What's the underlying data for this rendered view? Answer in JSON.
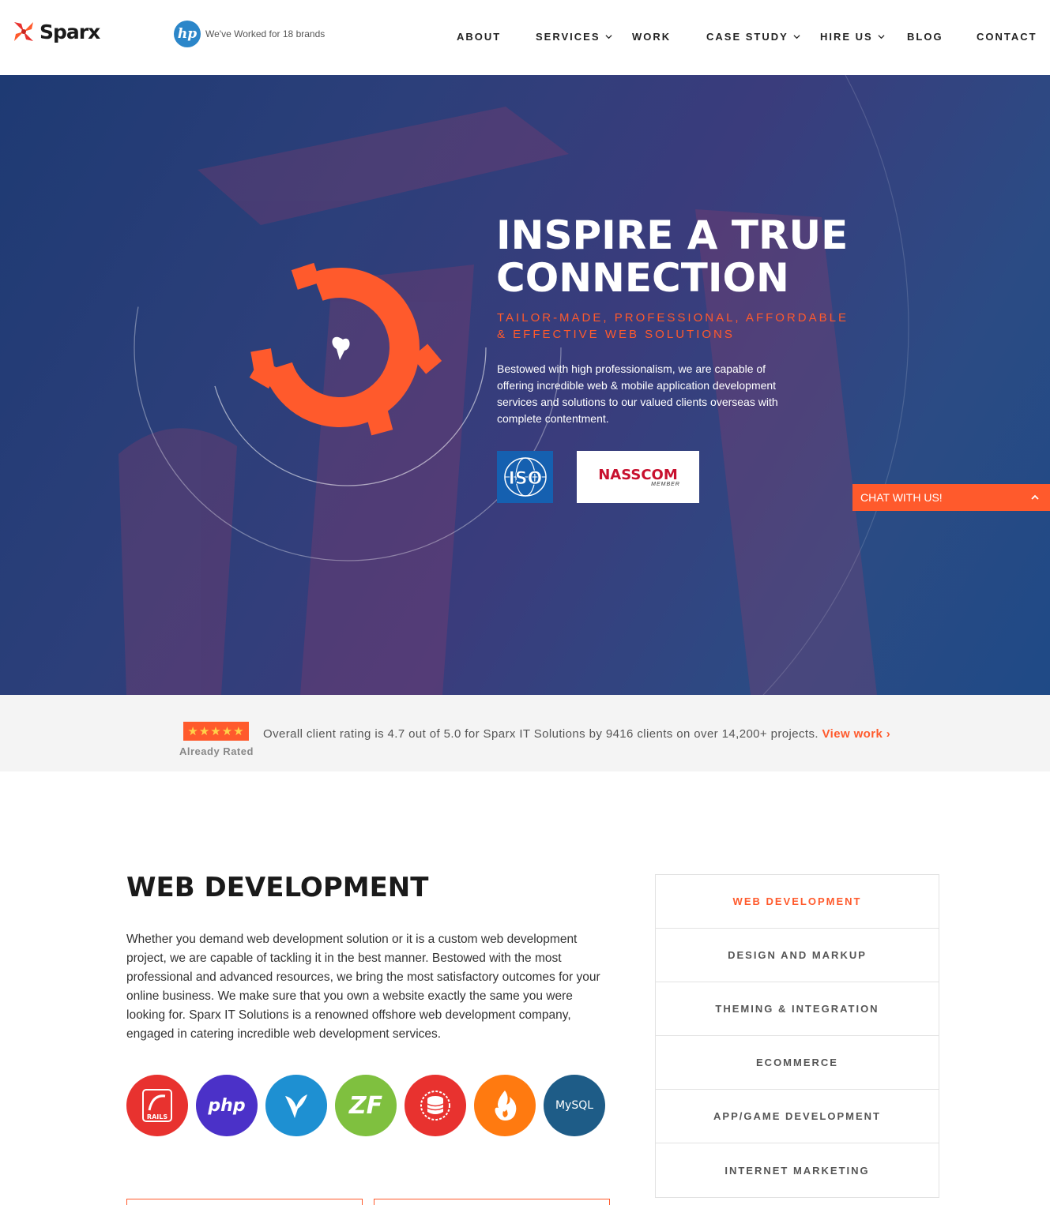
{
  "brand": {
    "name": "Sparx"
  },
  "header": {
    "brands_text": "We've Worked for 18 brands",
    "brand_logo": "hp",
    "nav": [
      {
        "label": "ABOUT",
        "dropdown": false
      },
      {
        "label": "SERVICES",
        "dropdown": true
      },
      {
        "label": "WORK",
        "dropdown": false
      },
      {
        "label": "CASE STUDY",
        "dropdown": true
      },
      {
        "label": "HIRE US",
        "dropdown": true
      },
      {
        "label": "BLOG",
        "dropdown": false
      },
      {
        "label": "CONTACT",
        "dropdown": false
      }
    ]
  },
  "hero": {
    "title_line1": "INSPIRE A TRUE",
    "title_line2": "CONNECTION",
    "subtitle": "TAILOR-MADE, PROFESSIONAL, AFFORDABLE & EFFECTIVE WEB SOLUTIONS",
    "description": "Bestowed with high professionalism, we are capable of offering incredible web & mobile application development services and solutions to our valued clients overseas with complete contentment.",
    "badges": {
      "iso": "ISO",
      "nasscom": "NASSCOM",
      "nasscom_sub": "MEMBER"
    },
    "chat_label": "CHAT WITH US!"
  },
  "rating": {
    "stars": "★★★★★",
    "already_rated": "Already Rated",
    "text": "Overall client rating is 4.7 out of 5.0 for Sparx IT Solutions by 9416 clients on over 14,200+ projects.",
    "link": "View work ›"
  },
  "web_dev": {
    "title": "WEB DEVELOPMENT",
    "text": "Whether you demand web development solution or it is a custom web development project, we are capable of tackling it in the best manner. Bestowed with the most professional and advanced resources, we bring the most satisfactory outcomes for your online business. We make sure that you own a website exactly the same you were looking for. Sparx IT Solutions is a renowned offshore web development company, engaged in catering incredible web development services.",
    "tech": [
      {
        "name": "rails-icon",
        "label": "RAILS",
        "color": "#e8322f"
      },
      {
        "name": "php-icon",
        "label": "php",
        "color": "#4b31c8"
      },
      {
        "name": "yii-icon",
        "label": "",
        "color": "#1e90d2"
      },
      {
        "name": "zend-icon",
        "label": "ZF",
        "color": "#7fc03f"
      },
      {
        "name": "database-icon",
        "label": "",
        "color": "#e8322f"
      },
      {
        "name": "codeigniter-icon",
        "label": "",
        "color": "#ff7a10"
      },
      {
        "name": "mysql-icon",
        "label": "MySQL",
        "color": "#1e5c87"
      }
    ],
    "menu": [
      {
        "label": "WEB DEVELOPMENT",
        "active": true
      },
      {
        "label": "DESIGN AND MARKUP",
        "active": false
      },
      {
        "label": "THEMING & INTEGRATION",
        "active": false
      },
      {
        "label": "ECOMMERCE",
        "active": false
      },
      {
        "label": "APP/GAME DEVELOPMENT",
        "active": false
      },
      {
        "label": "INTERNET MARKETING",
        "active": false
      }
    ]
  },
  "colors": {
    "accent": "#ff5a2c",
    "hero_bg": "#2c3f7a",
    "rating_bg": "#f4f4f4"
  }
}
